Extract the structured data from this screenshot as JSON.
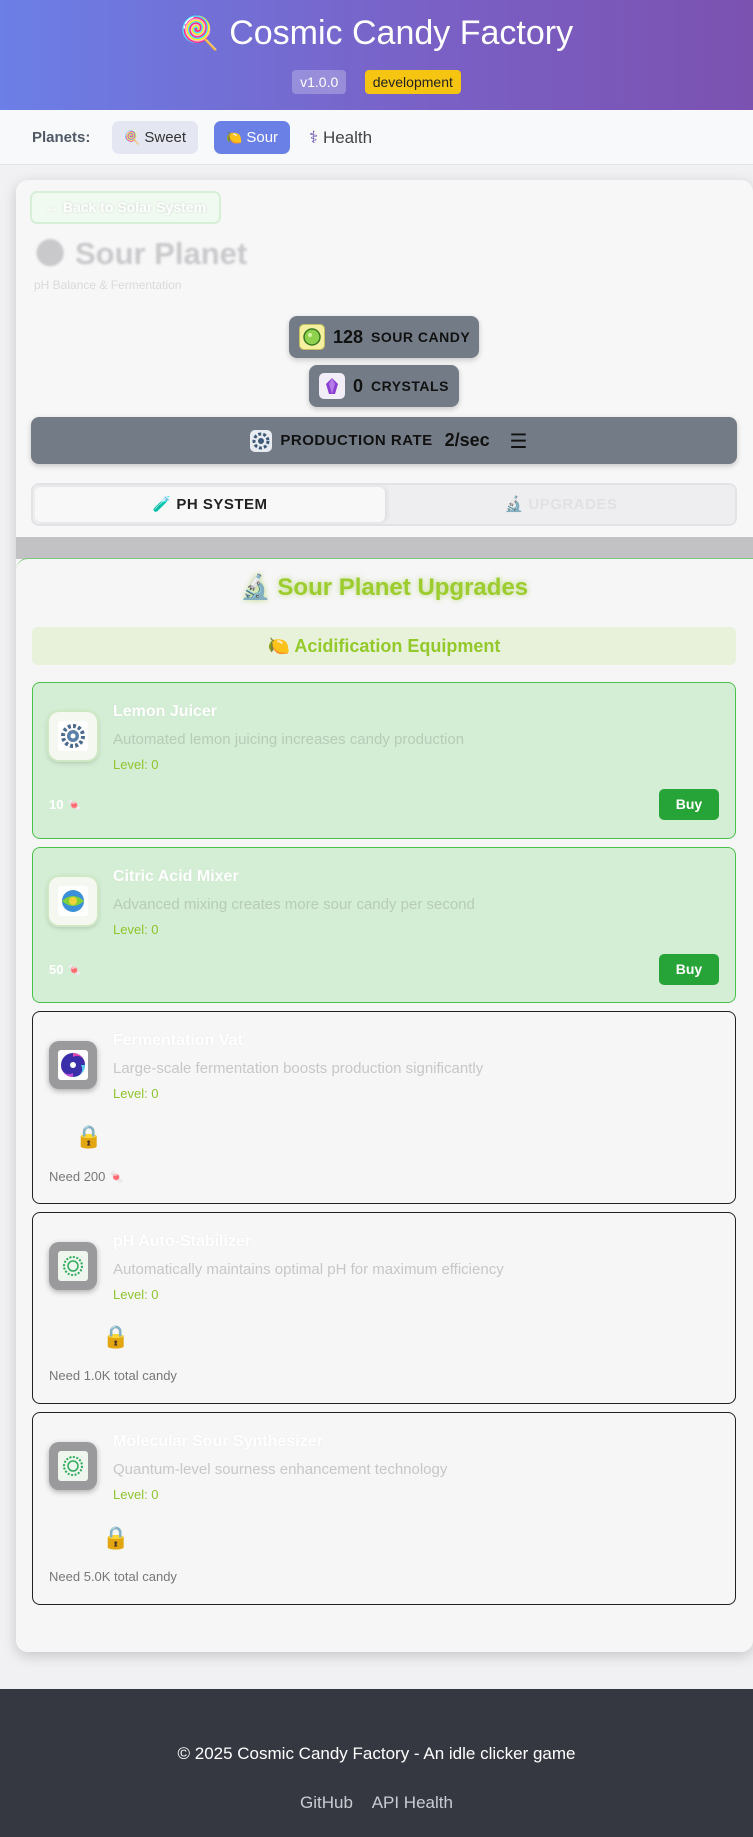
{
  "header": {
    "logo_icon": "lollipop-icon",
    "logo_glyph": "🍭",
    "title": "Cosmic Candy Factory",
    "version": "v1.0.0",
    "environment": "development"
  },
  "nav": {
    "label": "Planets:",
    "items": [
      {
        "icon": "🍭",
        "label": "Sweet"
      },
      {
        "icon": "🍋",
        "label": "Sour"
      },
      {
        "icon": "⚕",
        "label": "Health"
      }
    ],
    "active": "Sour"
  },
  "planet": {
    "back_label": "← Back to Solar System",
    "icon": "🌑",
    "title": "Sour Planet",
    "subtitle": "pH Balance & Fermentation"
  },
  "stats": {
    "candy_value": "128",
    "candy_label": "SOUR CANDY",
    "crystals_value": "0",
    "crystals_label": "CRYSTALS",
    "production_label": "PRODUCTION RATE",
    "production_value": "2/sec",
    "menu_glyph": "☰"
  },
  "tabs": [
    {
      "icon": "🧪",
      "label": "PH SYSTEM"
    },
    {
      "icon": "🔬",
      "label": "UPGRADES"
    }
  ],
  "upgrades_panel": {
    "title": "🔬 Sour Planet Upgrades",
    "section": "🍋 Acidification Equipment",
    "currency_icon": "🍬",
    "buy_label": "Buy",
    "lock_glyph": "🔒",
    "items": [
      {
        "name": "Lemon Juicer",
        "desc": "Automated lemon juicing increases candy production",
        "level": "Level: 0",
        "cost": "10",
        "state": "affordable",
        "icon": "gear-icon"
      },
      {
        "name": "Citric Acid Mixer",
        "desc": "Advanced mixing creates more sour candy per second",
        "level": "Level: 0",
        "cost": "50",
        "state": "affordable",
        "icon": "mixer-orb-icon"
      },
      {
        "name": "Fermentation Vat",
        "desc": "Large-scale fermentation boosts production significantly",
        "level": "Level: 0",
        "need": "Need 200",
        "state": "locked",
        "icon": "swirl-icon"
      },
      {
        "name": "pH Auto-Stabilizer",
        "desc": "Automatically maintains optimal pH for maximum efficiency",
        "level": "Level: 0",
        "need": "Need 1.0K total candy",
        "state": "locked",
        "icon": "ring-icon"
      },
      {
        "name": "Molecular Sour Synthesizer",
        "desc": "Quantum-level sourness enhancement technology",
        "level": "Level: 0",
        "need": "Need 5.0K total candy",
        "state": "locked",
        "icon": "ring-icon"
      }
    ]
  },
  "footer": {
    "copyright": "© 2025 Cosmic Candy Factory - An idle clicker game",
    "links": [
      "GitHub",
      "API Health"
    ]
  },
  "colors": {
    "header_gradient_start": "#6b7fe6",
    "header_gradient_end": "#7b52b0",
    "active_pill": "#6b80e6",
    "buy_button": "#27a438",
    "accent_green": "#94c92c"
  }
}
